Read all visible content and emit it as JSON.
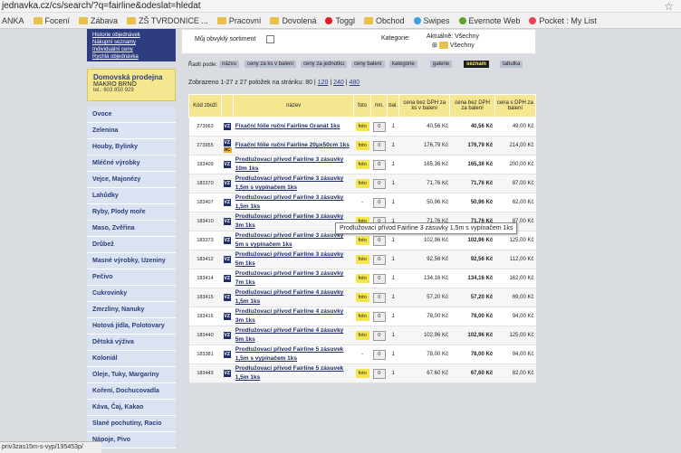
{
  "url": "jednavka.cz/cs/search/?q=fairline&odeslat=hledat",
  "bookmarks": [
    {
      "label": "ANKA",
      "icon": "none"
    },
    {
      "label": "Focení",
      "icon": "folder-icon"
    },
    {
      "label": "Zábava",
      "icon": "folder-icon"
    },
    {
      "label": "ZŠ TVRDONICE ...",
      "icon": "folder-icon"
    },
    {
      "label": "Pracovní",
      "icon": "folder-icon"
    },
    {
      "label": "Dovolená",
      "icon": "folder-icon"
    },
    {
      "label": "Toggl",
      "icon": "toggl-icon"
    },
    {
      "label": "Obchod",
      "icon": "folder-icon"
    },
    {
      "label": "Swipes",
      "icon": "swipes-icon"
    },
    {
      "label": "Evernote Web",
      "icon": "evernote-icon"
    },
    {
      "label": "Pocket : My List",
      "icon": "pocket-icon"
    }
  ],
  "account_links": [
    "Historie objednávek",
    "Nákupní seznamy",
    "Individuální ceny",
    "Rychlá objednávka"
  ],
  "store": {
    "title": "Domovská prodejna",
    "name": "MAKRO BRNO",
    "phone": "tel.: 603 850 929"
  },
  "categories": [
    "Ovoce",
    "Zelenina",
    "Houby, Bylinky",
    "Mléčné výrobky",
    "Vejce, Majonézy",
    "Lahůdky",
    "Ryby, Plody moře",
    "Maso, Zvěřina",
    "Drůbež",
    "Masné výrobky, Uzeniny",
    "Pečivo",
    "Cukrovinky",
    "Zmrzliny, Nanuky",
    "Hotová jídla, Polotovary",
    "Dětská výživa",
    "Koloniál",
    "Oleje, Tuky, Margariny",
    "Koření, Dochucovadla",
    "Káva, Čaj, Kakao",
    "Slané pochutiny, Racio",
    "Nápoje, Pivo"
  ],
  "options": {
    "my_assortment": "Můj obvyklý sortiment",
    "category_label": "Kategorie:",
    "current_label": "Aktuálně: Všechny",
    "all_label": "Všechny"
  },
  "sort": {
    "label": "Řadit podle:",
    "buttons": [
      "názvu",
      "ceny za ks v balení",
      "ceny za jednotku",
      "ceny balení",
      "kategorie"
    ]
  },
  "views": {
    "gallery": "galerie",
    "list": "seznam",
    "table": "tabulka"
  },
  "shown": {
    "text": "Zobrazeno 1-27 z 27 položek na stránku: 80 |",
    "pages": [
      "120",
      "240",
      "480"
    ]
  },
  "table": {
    "headers": [
      "Kód zboží",
      "název",
      "foto",
      "mn.",
      "bal.",
      "cena bez DPH za ks v balení",
      "cena bez DPH za balení",
      "cena s DPH za balení"
    ],
    "rows": [
      {
        "code": "273963",
        "nc": false,
        "name": "Fixační fólie ruční Fairline Granát 1ks",
        "foto": "foto",
        "qty": "0",
        "bal": "1",
        "p1": "40,56 Kč",
        "p2": "40,56 Kč",
        "p3": "49,00 Kč"
      },
      {
        "code": "273955",
        "nc": true,
        "name": "Fixační fólie ruční Fairline 20μx50cm 1ks",
        "foto": "foto",
        "qty": "0",
        "bal": "1",
        "p1": "176,79 Kč",
        "p2": "176,79 Kč",
        "p3": "214,00 Kč"
      },
      {
        "code": "183409",
        "nc": false,
        "name": "Prodlužovací přívod Fairline 3 zásuvky 10m 1ks",
        "foto": "foto",
        "qty": "0",
        "bal": "1",
        "p1": "165,36 Kč",
        "p2": "165,36 Kč",
        "p3": "200,00 Kč"
      },
      {
        "code": "183370",
        "nc": false,
        "name": "Prodlužovací přívod Fairline 3 zásuvky 1,5m s vypínačem 1ks",
        "foto": "foto",
        "qty": "0",
        "bal": "1",
        "p1": "71,76 Kč",
        "p2": "71,76 Kč",
        "p3": "87,00 Kč"
      },
      {
        "code": "183407",
        "nc": false,
        "name": "Prodlužovací přívod Fairline 3 zásuvky 1,5m 1ks",
        "foto": "-",
        "qty": "0",
        "bal": "1",
        "p1": "50,96 Kč",
        "p2": "50,96 Kč",
        "p3": "62,00 Kč"
      },
      {
        "code": "183410",
        "nc": false,
        "name": "Prodlužovací přívod Fairline 3 zásuvky 3m 1ks",
        "foto": "foto",
        "qty": "0",
        "bal": "1",
        "p1": "71,76 Kč",
        "p2": "71,76 Kč",
        "p3": "87,00 Kč"
      },
      {
        "code": "183373",
        "nc": false,
        "name": "Prodlužovací přívod Fairline 3 zásuvky 5m s vypínačem 1ks",
        "foto": "foto",
        "qty": "0",
        "bal": "1",
        "p1": "102,96 Kč",
        "p2": "102,96 Kč",
        "p3": "125,00 Kč"
      },
      {
        "code": "183412",
        "nc": false,
        "name": "Prodlužovací přívod Fairline 3 zásuvky 5m 1ks",
        "foto": "foto",
        "qty": "0",
        "bal": "1",
        "p1": "92,56 Kč",
        "p2": "92,56 Kč",
        "p3": "112,00 Kč"
      },
      {
        "code": "183414",
        "nc": false,
        "name": "Prodlužovací přívod Fairline 3 zásuvky 7m 1ks",
        "foto": "foto",
        "qty": "0",
        "bal": "1",
        "p1": "134,16 Kč",
        "p2": "134,16 Kč",
        "p3": "162,00 Kč"
      },
      {
        "code": "183415",
        "nc": false,
        "name": "Prodlužovací přívod Fairline 4 zásuvky 1,5m 1ks",
        "foto": "foto",
        "qty": "0",
        "bal": "1",
        "p1": "57,20 Kč",
        "p2": "57,20 Kč",
        "p3": "69,00 Kč"
      },
      {
        "code": "183416",
        "nc": false,
        "name": "Prodlužovací přívod Fairline 4 zásuvky 3m 1ks",
        "foto": "foto",
        "qty": "0",
        "bal": "1",
        "p1": "78,00 Kč",
        "p2": "78,00 Kč",
        "p3": "94,00 Kč"
      },
      {
        "code": "183440",
        "nc": false,
        "name": "Prodlužovací přívod Fairline 4 zásuvky 5m 1ks",
        "foto": "foto",
        "qty": "0",
        "bal": "1",
        "p1": "102,96 Kč",
        "p2": "102,96 Kč",
        "p3": "125,00 Kč"
      },
      {
        "code": "183381",
        "nc": false,
        "name": "Prodlužovací přívod Fairline 5 zásuvek 1,5m s vypínačem 1ks",
        "foto": "-",
        "qty": "0",
        "bal": "1",
        "p1": "78,00 Kč",
        "p2": "78,00 Kč",
        "p3": "94,00 Kč"
      },
      {
        "code": "183443",
        "nc": false,
        "name": "Prodlužovací přívod Fairline 5 zásuvek 1,5m 1ks",
        "foto": "foto",
        "qty": "0",
        "bal": "1",
        "p1": "67,60 Kč",
        "p2": "67,60 Kč",
        "p3": "82,00 Kč"
      }
    ]
  },
  "tooltip": "Prodlužovací přívod Fairline 3 zásuvky 1,5m s vypínačem 1ks",
  "status_url": "priv3zas15m-s-vyp/195453p/"
}
